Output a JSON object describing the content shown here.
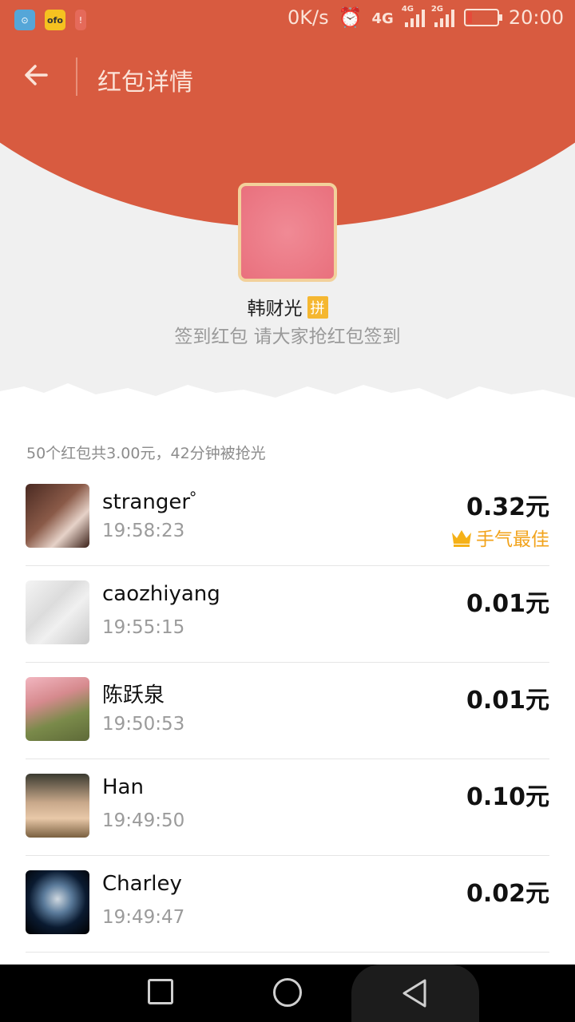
{
  "status_bar": {
    "apps": [
      "location",
      "ofo",
      "battery-saver"
    ],
    "ofo_label": "ofo",
    "net_speed": "0K/s",
    "sim1_type": "4G",
    "sim1_sub": "4G",
    "sim2_type": "2G",
    "time": "20:00"
  },
  "header": {
    "title": "红包详情"
  },
  "sender": {
    "name": "韩财光",
    "badge": "拼",
    "greeting": "签到红包 请大家抢红包签到"
  },
  "summary": "50个红包共3.00元，42分钟被抢光",
  "best_label": "手气最佳",
  "records": [
    {
      "name": "stranger゜",
      "time": "19:58:23",
      "amount": "0.32元",
      "best": true
    },
    {
      "name": "caozhiyang",
      "time": "19:55:15",
      "amount": "0.01元",
      "best": false
    },
    {
      "name": "陈跃泉",
      "time": "19:50:53",
      "amount": "0.01元",
      "best": false
    },
    {
      "name": "Han",
      "time": "19:49:50",
      "amount": "0.10元",
      "best": false
    },
    {
      "name": "Charley",
      "time": "19:49:47",
      "amount": "0.02元",
      "best": false
    }
  ],
  "colors": {
    "header_red": "#d85b40",
    "gold": "#f2a31b",
    "avatar_border": "#f2d19b"
  }
}
